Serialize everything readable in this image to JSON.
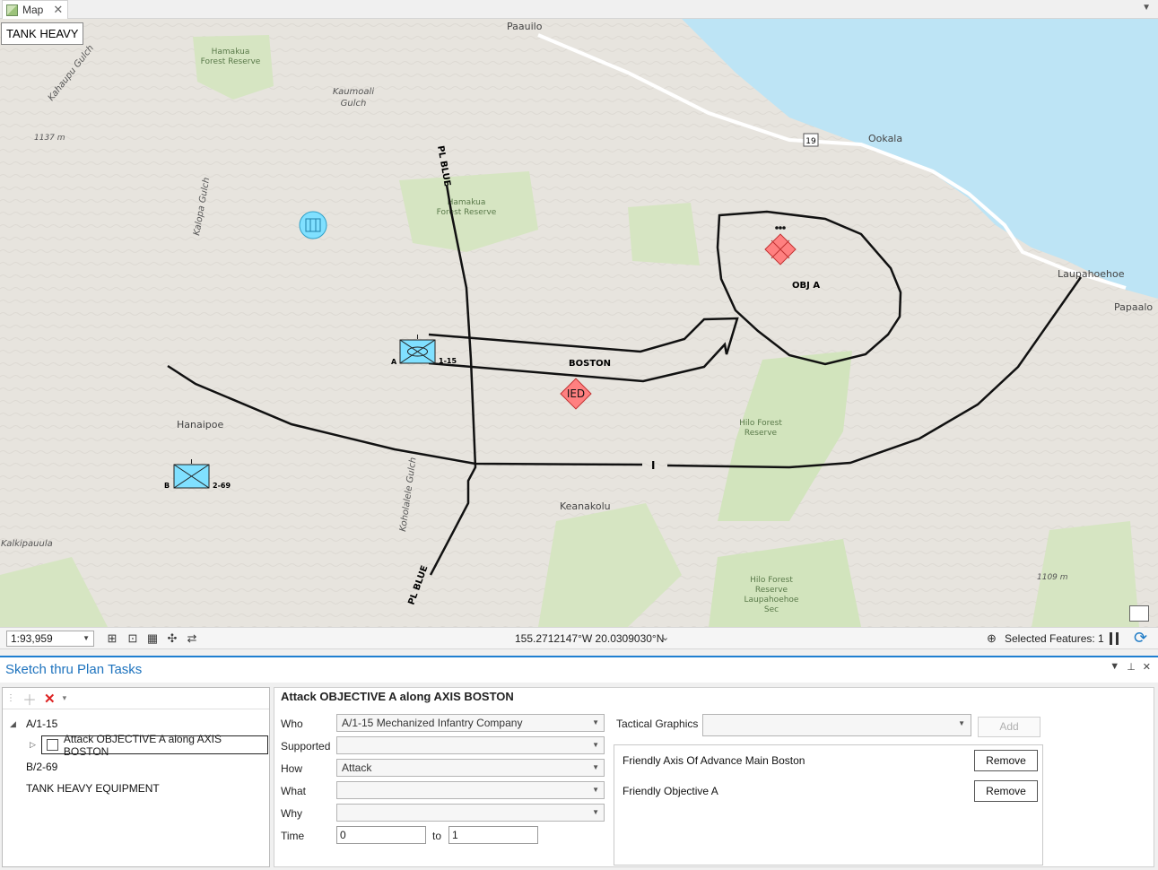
{
  "tab": {
    "label": "Map"
  },
  "map": {
    "title": "TANK HEAVY",
    "labels": {
      "paauilo": "Paauilo",
      "ookala": "Ookala",
      "laupahoehoe": "Laupahoehoe",
      "papaalo": "Papaalo",
      "hamakua_forest_1": [
        "Hamakua",
        "Forest Reserve"
      ],
      "hamakua_forest_2": [
        "Hamakua",
        "Forest Reserve"
      ],
      "kaumoali": [
        "Kaumoali",
        "Gulch"
      ],
      "kahaupu": "Kahaupu Gulch",
      "kalopa": "Kalopa Gulch",
      "elev_1137": "1137 m",
      "elev_1109": "1109 m",
      "hanaipoe": "Hanaipoe",
      "keanakolu": "Keanakolu",
      "kalkipauula": "Kalkipauula",
      "koholalele": "Koholalele Gulch",
      "hilo_forest_1": [
        "Hilo Forest",
        "Reserve"
      ],
      "hilo_forest_2": [
        "Hilo Forest",
        "Reserve",
        "Laupahoehoe",
        "Sec"
      ],
      "route_19": "19"
    },
    "graphics": {
      "pl_blue_top": "PL BLUE",
      "pl_blue_bottom": "PL BLUE",
      "axis_label": "BOSTON",
      "obj_label": "OBJ A",
      "ied_label": "IED",
      "unit_a_left": "A",
      "unit_a_right": "1-15",
      "unit_b_left": "B",
      "unit_b_right": "2-69",
      "boundary_mark": "I"
    },
    "colors": {
      "water": "#bde4f5",
      "forest": "#cfe2b9",
      "friendly": "#80e0ff",
      "hostile": "#ff8080"
    }
  },
  "statusbar": {
    "scale": "1:93,959",
    "coordinates": "155.2712147°W 20.0309030°N",
    "selected_features": "Selected Features: 1"
  },
  "pane": {
    "title": "Sketch thru Plan Tasks",
    "tree": {
      "items": [
        {
          "label": "A/1-15"
        },
        {
          "label": "Attack OBJECTIVE A along AXIS BOSTON"
        },
        {
          "label": "B/2-69"
        },
        {
          "label": "TANK HEAVY EQUIPMENT"
        }
      ]
    },
    "form": {
      "title": "Attack OBJECTIVE A along AXIS BOSTON",
      "labels": {
        "who": "Who",
        "supported": "Supported",
        "how": "How",
        "what": "What",
        "why": "Why",
        "time": "Time",
        "to": "to"
      },
      "values": {
        "who": "A/1-15 Mechanized Infantry Company",
        "supported": "",
        "how": "Attack",
        "what": "",
        "why": "",
        "time_from": "0",
        "time_to": "1"
      },
      "tactical_graphics_label": "Tactical Graphics",
      "add_label": "Add",
      "graphics": [
        {
          "name": "Friendly Axis Of Advance Main Boston",
          "remove": "Remove"
        },
        {
          "name": "Friendly Objective A",
          "remove": "Remove"
        }
      ]
    }
  }
}
